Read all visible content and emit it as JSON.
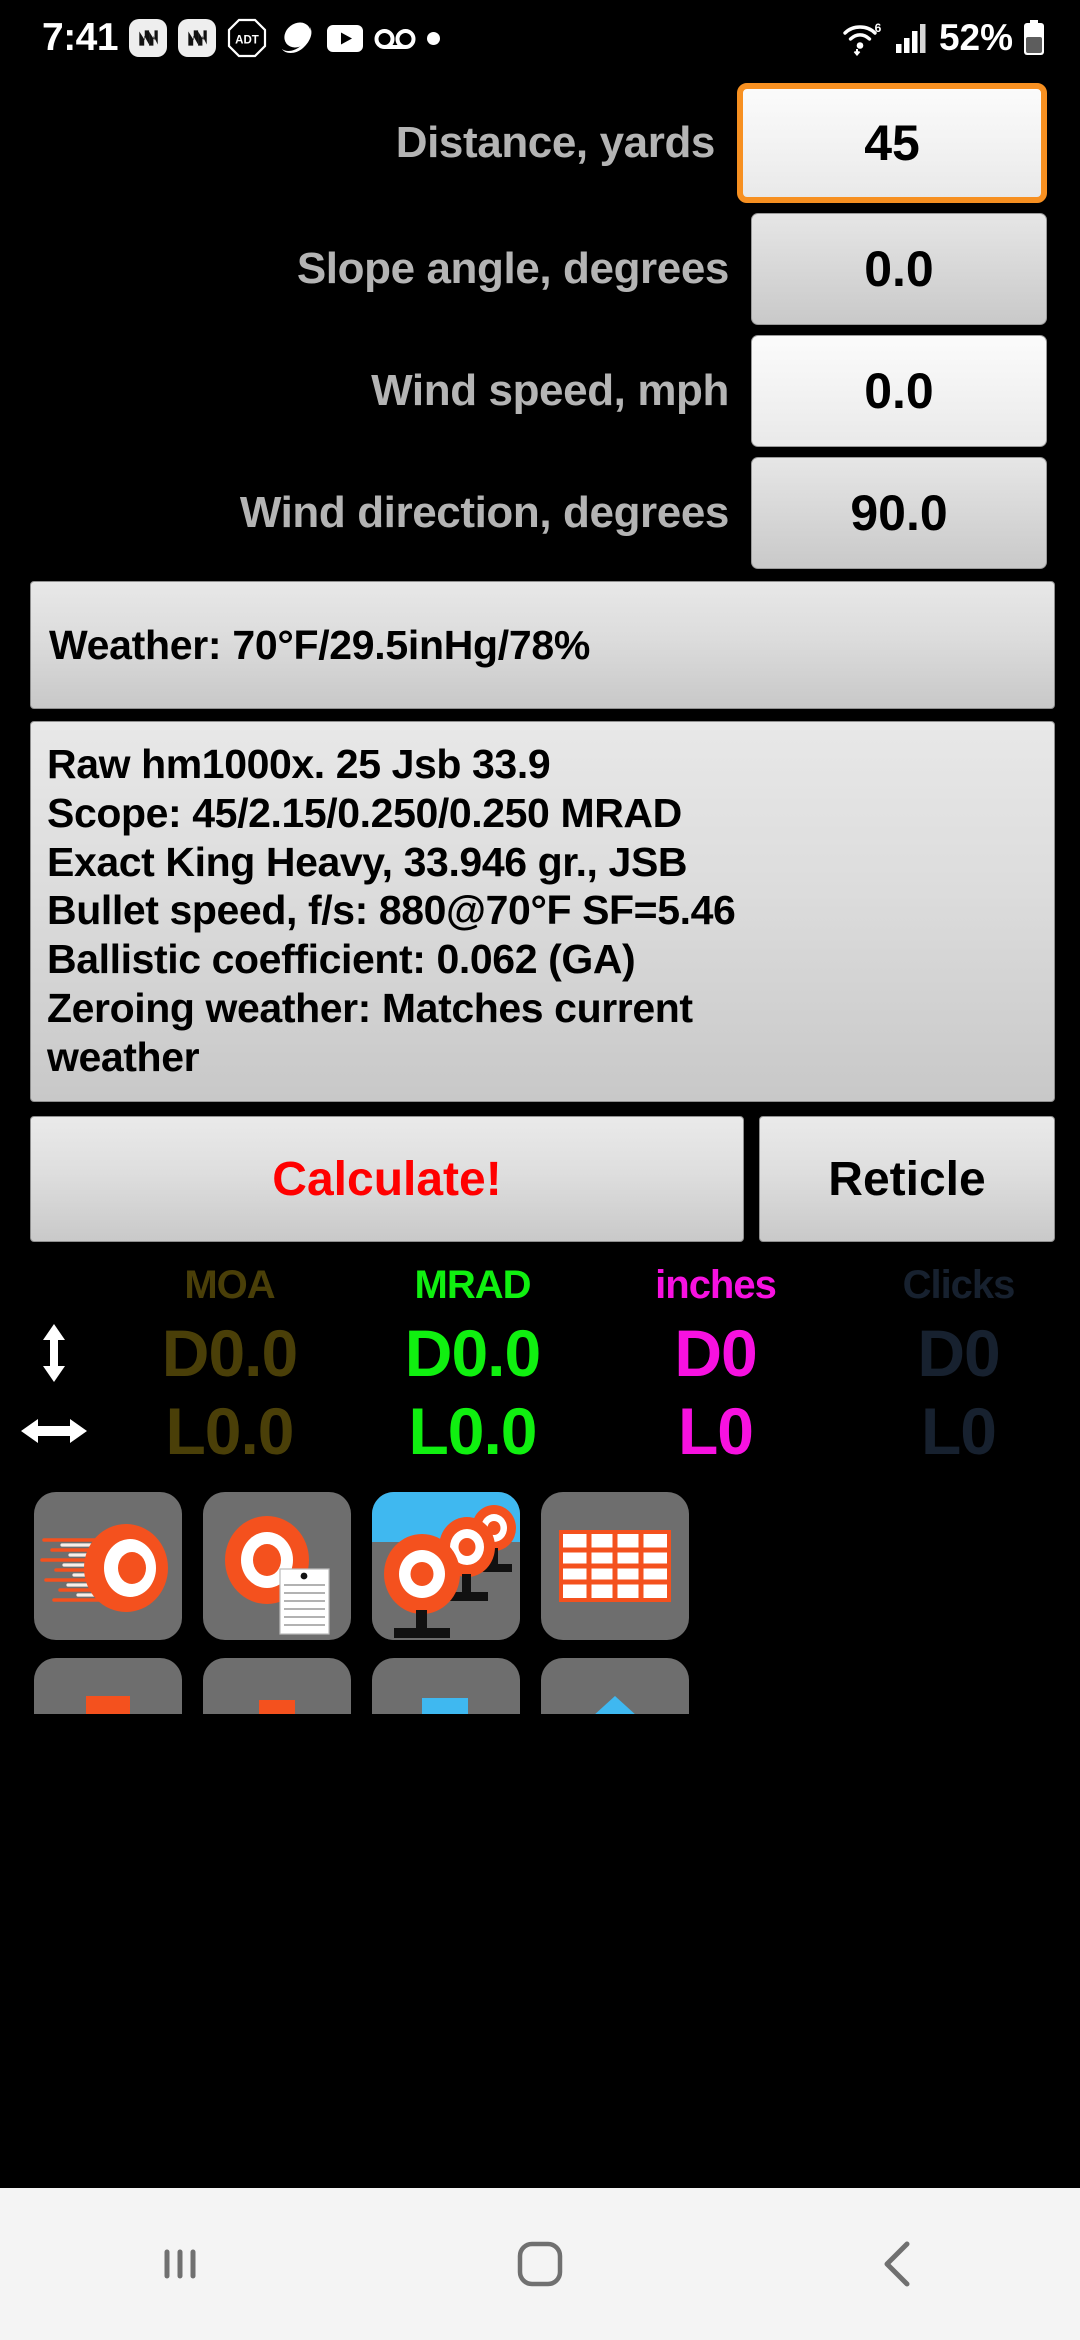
{
  "status_bar": {
    "clock": "7:41",
    "battery_percent": "52%",
    "left_icons": [
      "news-app-icon",
      "news-app-icon",
      "adt-security-icon",
      "samsung-internet-icon",
      "youtube-icon",
      "voicemail-icon",
      "dot-icon"
    ],
    "adt_label": "ADT",
    "right_icons": [
      "wifi-6-icon",
      "cellular-signal-icon",
      "battery-icon"
    ],
    "wifi_gen": "6"
  },
  "inputs": [
    {
      "label": "Distance, yards",
      "value": "45",
      "focused": true,
      "style": "light"
    },
    {
      "label": "Slope angle, degrees",
      "value": "0.0",
      "focused": false,
      "style": "dim"
    },
    {
      "label": "Wind speed, mph",
      "value": "0.0",
      "focused": false,
      "style": "light"
    },
    {
      "label": "Wind direction, degrees",
      "value": "90.0",
      "focused": false,
      "style": "dim"
    }
  ],
  "weather_bar": {
    "text": "Weather: 70°F/29.5inHg/78%"
  },
  "info_panel": {
    "lines": [
      "Raw hm1000x. 25  Jsb 33.9",
      "Scope: 45/2.15/0.250/0.250 MRAD",
      "Exact King Heavy, 33.946 gr., JSB",
      "Bullet speed, f/s: 880@70°F SF=5.46",
      "Ballistic coefficient: 0.062 (GA)",
      "Zeroing weather: Matches current",
      "weather"
    ]
  },
  "buttons": {
    "calculate": "Calculate!",
    "reticle": "Reticle"
  },
  "results": {
    "headers": [
      {
        "label": "MOA",
        "color": "#4a3f08"
      },
      {
        "label": "MRAD",
        "color": "#10f010"
      },
      {
        "label": "inches",
        "color": "#f711e0"
      },
      {
        "label": "Clicks",
        "color": "#17212f"
      }
    ],
    "rows": [
      {
        "arrow": "vertical-arrow-icon",
        "cells": [
          {
            "value": "D0.0",
            "color": "#4a3f08"
          },
          {
            "value": "D0.0",
            "color": "#10f010"
          },
          {
            "value": "D0",
            "color": "#f711e0"
          },
          {
            "value": "D0",
            "color": "#17212f"
          }
        ]
      },
      {
        "arrow": "horizontal-arrow-icon",
        "cells": [
          {
            "value": "L0.0",
            "color": "#4a3f08"
          },
          {
            "value": "L0.0",
            "color": "#10f010"
          },
          {
            "value": "L0",
            "color": "#f711e0"
          },
          {
            "value": "L0",
            "color": "#17212f"
          }
        ]
      }
    ]
  },
  "icon_grid": {
    "tiles": [
      {
        "name": "speed-target-icon"
      },
      {
        "name": "target-notes-icon"
      },
      {
        "name": "multi-target-outdoor-icon"
      },
      {
        "name": "table-grid-icon"
      }
    ],
    "tiles_partial": [
      {
        "name": "partial-tile-orange-icon"
      },
      {
        "name": "partial-tile-orange-2-icon"
      },
      {
        "name": "partial-tile-blue-icon"
      },
      {
        "name": "partial-tile-triangle-icon"
      }
    ]
  },
  "nav_bar": {
    "items": [
      "recents-button",
      "home-button",
      "back-button"
    ]
  },
  "colors": {
    "accent_orange": "#f79021",
    "calculate_red": "#ff0000",
    "moa": "#4a3f08",
    "mrad": "#10f010",
    "inches": "#f711e0",
    "clicks": "#17212f",
    "label_gray": "#b4b4b4",
    "tile_gray": "#6e6e6e",
    "tile_orange": "#f4511e"
  }
}
